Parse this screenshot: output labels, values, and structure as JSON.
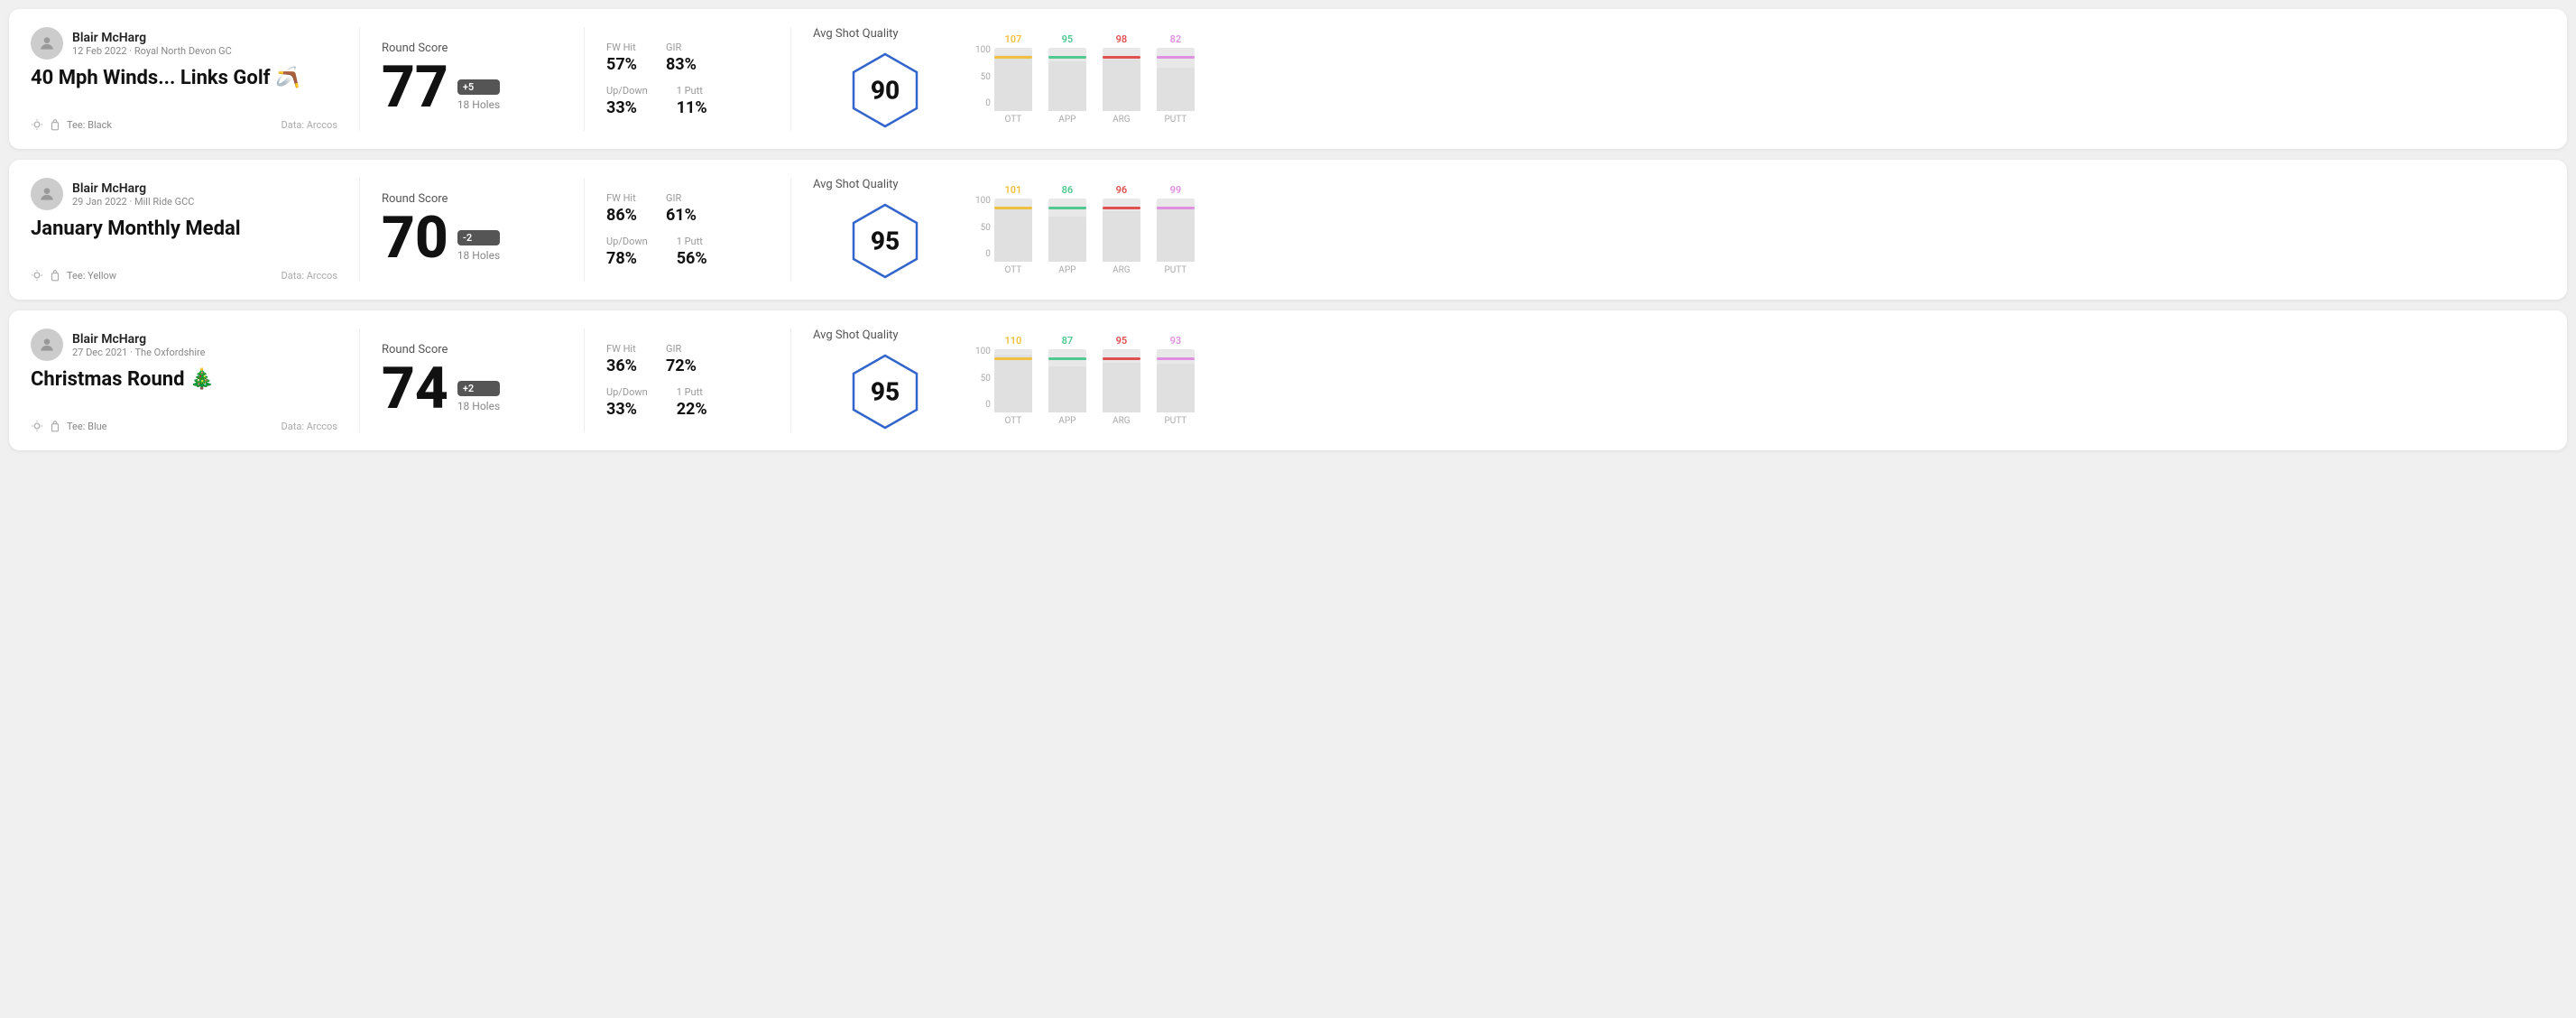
{
  "rounds": [
    {
      "id": "round1",
      "user": {
        "name": "Blair McHarg",
        "date_course": "12 Feb 2022 · Royal North Devon GC"
      },
      "title": "40 Mph Winds... Links Golf 🪃",
      "tee": "Black",
      "data_source": "Data: Arccos",
      "round_score_label": "Round Score",
      "score": "77",
      "score_badge": "+5",
      "holes": "18 Holes",
      "fw_hit_label": "FW Hit",
      "fw_hit": "57%",
      "gir_label": "GIR",
      "gir": "83%",
      "updown_label": "Up/Down",
      "updown": "33%",
      "oneputt_label": "1 Putt",
      "oneputt": "11%",
      "quality_label": "Avg Shot Quality",
      "quality_score": "90",
      "bars": [
        {
          "label": "OTT",
          "value": 107,
          "color": "#f0c040"
        },
        {
          "label": "APP",
          "value": 95,
          "color": "#50c890"
        },
        {
          "label": "ARG",
          "value": 98,
          "color": "#e05050"
        },
        {
          "label": "PUTT",
          "value": 82,
          "color": "#e090e0"
        }
      ]
    },
    {
      "id": "round2",
      "user": {
        "name": "Blair McHarg",
        "date_course": "29 Jan 2022 · Mill Ride GCC"
      },
      "title": "January Monthly Medal",
      "tee": "Yellow",
      "data_source": "Data: Arccos",
      "round_score_label": "Round Score",
      "score": "70",
      "score_badge": "-2",
      "holes": "18 Holes",
      "fw_hit_label": "FW Hit",
      "fw_hit": "86%",
      "gir_label": "GIR",
      "gir": "61%",
      "updown_label": "Up/Down",
      "updown": "78%",
      "oneputt_label": "1 Putt",
      "oneputt": "56%",
      "quality_label": "Avg Shot Quality",
      "quality_score": "95",
      "bars": [
        {
          "label": "OTT",
          "value": 101,
          "color": "#f0c040"
        },
        {
          "label": "APP",
          "value": 86,
          "color": "#50c890"
        },
        {
          "label": "ARG",
          "value": 96,
          "color": "#e05050"
        },
        {
          "label": "PUTT",
          "value": 99,
          "color": "#e090e0"
        }
      ]
    },
    {
      "id": "round3",
      "user": {
        "name": "Blair McHarg",
        "date_course": "27 Dec 2021 · The Oxfordshire"
      },
      "title": "Christmas Round 🎄",
      "tee": "Blue",
      "data_source": "Data: Arccos",
      "round_score_label": "Round Score",
      "score": "74",
      "score_badge": "+2",
      "holes": "18 Holes",
      "fw_hit_label": "FW Hit",
      "fw_hit": "36%",
      "gir_label": "GIR",
      "gir": "72%",
      "updown_label": "Up/Down",
      "updown": "33%",
      "oneputt_label": "1 Putt",
      "oneputt": "22%",
      "quality_label": "Avg Shot Quality",
      "quality_score": "95",
      "bars": [
        {
          "label": "OTT",
          "value": 110,
          "color": "#f0c040"
        },
        {
          "label": "APP",
          "value": 87,
          "color": "#50c890"
        },
        {
          "label": "ARG",
          "value": 95,
          "color": "#e05050"
        },
        {
          "label": "PUTT",
          "value": 93,
          "color": "#e090e0"
        }
      ]
    }
  ]
}
